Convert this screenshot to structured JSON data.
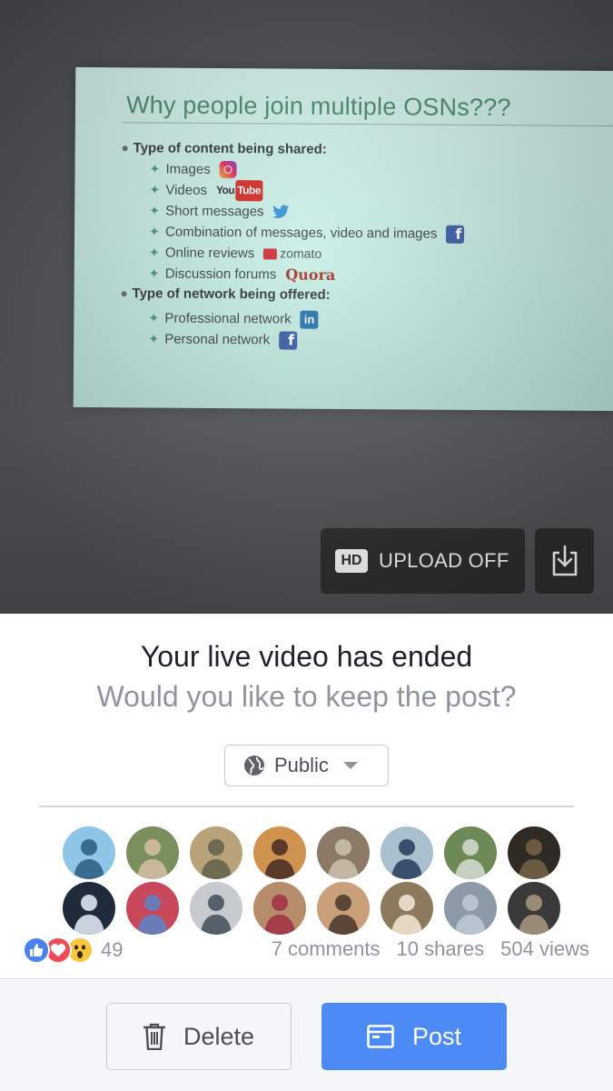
{
  "slide": {
    "title": "Why people join multiple OSNs???",
    "sections": [
      {
        "heading": "Type of content being shared:",
        "items": [
          {
            "text": "Images",
            "logo": "instagram-logo"
          },
          {
            "text": "Videos",
            "logo": "youtube-logo",
            "logo_text": "You",
            "logo_text_2": "Tube"
          },
          {
            "text": "Short messages",
            "logo": "twitter-logo"
          },
          {
            "text": "Combination of messages, video and images",
            "logo": "facebook-logo"
          },
          {
            "text": "Online reviews",
            "logo": "zomato-logo",
            "logo_text": "zomato"
          },
          {
            "text": "Discussion forums",
            "logo": "quora-logo",
            "logo_text": "Quora"
          }
        ]
      },
      {
        "heading": "Type of network being offered:",
        "items": [
          {
            "text": "Professional network",
            "logo": "linkedin-logo"
          },
          {
            "text": "Personal network",
            "logo": "facebook-logo"
          }
        ]
      }
    ]
  },
  "video_controls": {
    "hd_badge": "HD",
    "upload_label": "UPLOAD OFF",
    "download_icon": "download-icon"
  },
  "live_ended": {
    "title": "Your live video has ended",
    "subtitle": "Would you like to keep the post?"
  },
  "privacy": {
    "icon": "globe-icon",
    "label": "Public",
    "caret_icon": "chevron-down-icon"
  },
  "viewers": {
    "count": 16,
    "avatar_colors": [
      [
        "#8fc6e8",
        "#3a6c8f"
      ],
      [
        "#7a8f5c",
        "#c9b89a"
      ],
      [
        "#b7a27a",
        "#6f6a52"
      ],
      [
        "#d0934f",
        "#5a3a2a"
      ],
      [
        "#8a7a66",
        "#c2b7a4"
      ],
      [
        "#a9c0cf",
        "#38506b"
      ],
      [
        "#6d8a56",
        "#c7cfc0"
      ],
      [
        "#2f2a24",
        "#6a5a40"
      ],
      [
        "#1f2a3a",
        "#c9d2dd"
      ],
      [
        "#c8475a",
        "#6b7bb5"
      ],
      [
        "#c7cbd0",
        "#55606b"
      ],
      [
        "#b68c6a",
        "#a33d4a"
      ],
      [
        "#c9a07a",
        "#5a4536"
      ],
      [
        "#8d7a5e",
        "#e4d7c3"
      ],
      [
        "#8c9aa8",
        "#b7c3cf"
      ],
      [
        "#3b3a3a",
        "#9a8b76"
      ]
    ]
  },
  "reactions": {
    "types": [
      "like-icon",
      "love-icon",
      "wow-icon"
    ],
    "count": "49",
    "colors": {
      "like": "#4b82f0",
      "love": "#f04b5a",
      "wow": "#f7c83f"
    }
  },
  "stats": {
    "comments": "7 comments",
    "shares": "10 shares",
    "views": "504 views"
  },
  "actions": {
    "delete_label": "Delete",
    "delete_icon": "trash-icon",
    "post_label": "Post",
    "post_icon": "post-icon",
    "post_color": "#4c8af5"
  }
}
